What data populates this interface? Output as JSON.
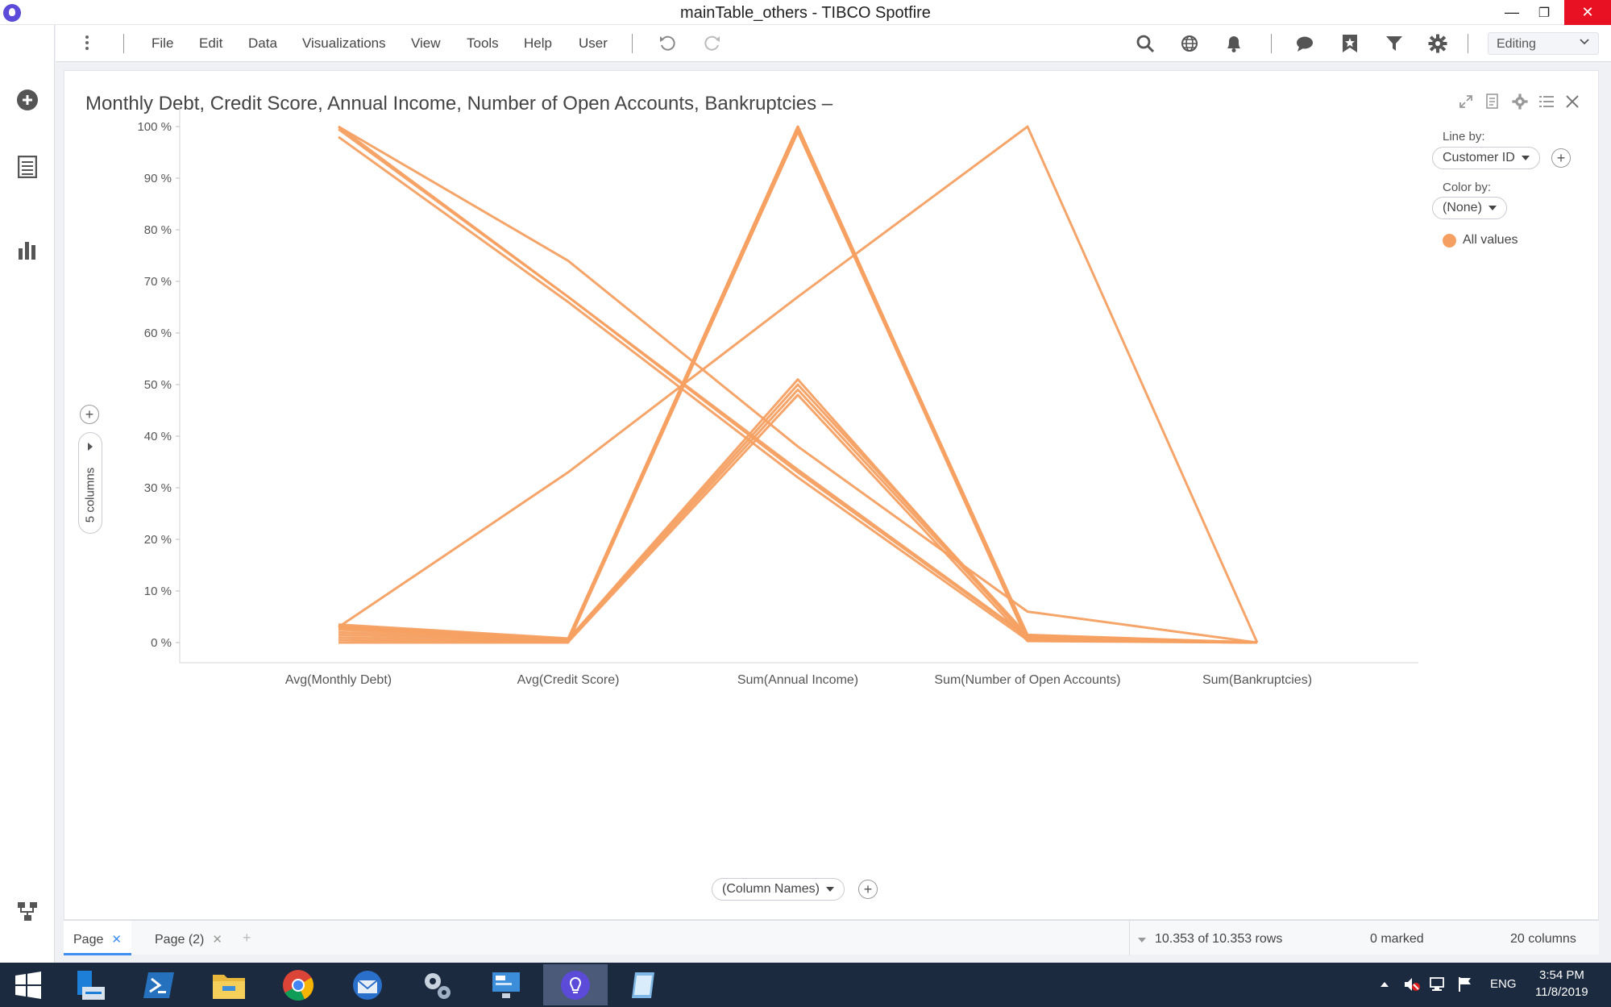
{
  "window": {
    "title": "mainTable_others - TIBCO Spotfire",
    "minimize": "—",
    "restore": "❐",
    "close": "✕"
  },
  "menu": {
    "items": [
      "File",
      "Edit",
      "Data",
      "Visualizations",
      "View",
      "Tools",
      "Help",
      "User"
    ],
    "mode_label": "Editing"
  },
  "visualization": {
    "title": "Monthly Debt, Credit Score, Annual Income, Number of Open Accounts, Bankruptcies –",
    "line_by_label": "Line by:",
    "line_by_value": "Customer ID",
    "color_by_label": "Color by:",
    "color_by_value": "(None)",
    "legend_item": "All values",
    "columns_selector": "5 columns",
    "x_selector": "(Column Names)"
  },
  "chart_data": {
    "type": "line",
    "subtype": "parallel-coordinates",
    "x": [
      "Avg(Monthly Debt)",
      "Avg(Credit Score)",
      "Sum(Annual Income)",
      "Sum(Number of Open Accounts)",
      "Sum(Bankruptcies)"
    ],
    "y_ticks": [
      "0 %",
      "10 %",
      "20 %",
      "30 %",
      "40 %",
      "50 %",
      "60 %",
      "70 %",
      "80 %",
      "90 %",
      "100 %"
    ],
    "ylim": [
      0,
      100
    ],
    "color": "#f5a062",
    "grid": false,
    "legend_position": "right",
    "series": [
      {
        "values": [
          100,
          67,
          33,
          1,
          0
        ]
      },
      {
        "values": [
          99.5,
          67,
          33.5,
          1.2,
          0
        ]
      },
      {
        "values": [
          100,
          74,
          38,
          6,
          0
        ]
      },
      {
        "values": [
          3,
          33,
          67,
          100,
          0
        ]
      },
      {
        "values": [
          3,
          0.5,
          100,
          1,
          0
        ]
      },
      {
        "values": [
          2,
          0.3,
          99.5,
          1.5,
          0
        ]
      },
      {
        "values": [
          2.5,
          0.3,
          99,
          1.2,
          0
        ]
      },
      {
        "values": [
          3.5,
          0.8,
          100,
          0.5,
          0
        ]
      },
      {
        "values": [
          1,
          0.2,
          99.5,
          0.8,
          0
        ]
      },
      {
        "values": [
          0,
          0,
          99,
          0.4,
          0
        ]
      },
      {
        "values": [
          1.5,
          0.4,
          49,
          1,
          0
        ]
      },
      {
        "values": [
          3.2,
          0.6,
          51,
          0.8,
          0
        ]
      },
      {
        "values": [
          0.5,
          0.1,
          48,
          0.3,
          0
        ]
      },
      {
        "values": [
          2.8,
          0.5,
          50,
          1.4,
          0
        ]
      },
      {
        "values": [
          98,
          66,
          32,
          0.5,
          0
        ]
      }
    ]
  },
  "statusbar": {
    "tabs": [
      "Page",
      "Page (2)"
    ],
    "add_page": "+",
    "rows": "10.353 of 10.353 rows",
    "marked": "0 marked",
    "columns": "20 columns"
  },
  "taskbar": {
    "lang": "ENG",
    "time": "3:54 PM",
    "date": "11/8/2019"
  }
}
